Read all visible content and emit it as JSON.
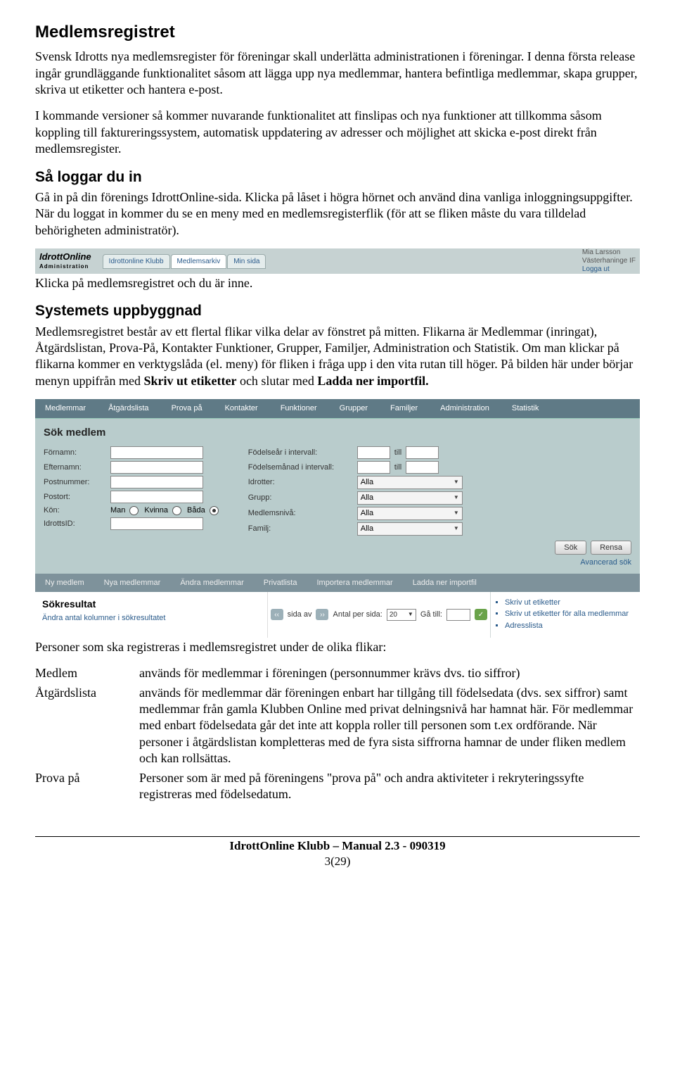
{
  "h1": "Medlemsregistret",
  "p1": "Svensk Idrotts nya medlemsregister för föreningar skall underlätta administrationen i föreningar. I denna första release ingår grundläggande funktionalitet såsom att lägga upp nya medlemmar, hantera befintliga medlemmar, skapa grupper, skriva ut etiketter och hantera e-post.",
  "p2": "I kommande versioner så kommer nuvarande funktionalitet att finslipas och nya funktioner att tillkomma såsom koppling till faktureringssystem, automatisk uppdatering av adresser och möjlighet att skicka e-post direkt från medlemsregister.",
  "h2a": "Så loggar du in",
  "p3": "Gå in på din förenings IdrottOnline-sida. Klicka på låset i högra hörnet och använd dina vanliga inloggningsuppgifter. När du loggat in kommer du se en meny med en medlemsregisterflik (för att se fliken måste du vara tilldelad behörigheten administratör).",
  "banner1": {
    "logo1": "IdrottOnline",
    "logo2": "Administration",
    "tabs": [
      "Idrottonline Klubb",
      "Medlemsarkiv",
      "Min sida"
    ],
    "activeTab": 1,
    "userName": "Mia Larsson",
    "userOrg": "Västerhaninge IF",
    "logout": "Logga ut"
  },
  "p4": "Klicka på medlemsregistret och du är inne.",
  "h2b": "Systemets uppbyggnad",
  "p5a": "Medlemsregistret består av ett flertal flikar vilka delar av fönstret på mitten. Flikarna är Medlemmar (inringat), Åtgärdslistan, Prova-På, Kontakter  Funktioner, Grupper, Familjer, Administration och Statistik. Om man klickar på flikarna kommer en verktygslåda (el. meny) för fliken i fråga upp i den vita rutan till höger. På bilden här under börjar menyn uppifrån med ",
  "p5b": "Skriv ut etiketter",
  "p5c": " och slutar med ",
  "p5d": "Ladda ner importfil.",
  "shot2": {
    "topbar": [
      "Medlemmar",
      "Åtgärdslista",
      "Prova på",
      "Kontakter",
      "Funktioner",
      "Grupper",
      "Familjer",
      "Administration",
      "Statistik"
    ],
    "panelTitle": "Sök medlem",
    "leftLabels": {
      "fornamn": "Förnamn:",
      "efternamn": "Efternamn:",
      "postnummer": "Postnummer:",
      "postort": "Postort:",
      "kon": "Kön:",
      "idrottsid": "IdrottsID:"
    },
    "konOptions": {
      "man": "Man",
      "kvinna": "Kvinna",
      "bada": "Båda"
    },
    "rightLabels": {
      "fodelsear": "Födelseår i intervall:",
      "fodelsemanad": "Födelsemånad i intervall:",
      "idrotter": "Idrotter:",
      "grupp": "Grupp:",
      "medlemsniva": "Medlemsnivå:",
      "familj": "Familj:"
    },
    "till": "till",
    "alla": "Alla",
    "btnSok": "Sök",
    "btnRensa": "Rensa",
    "adv": "Avancerad sök",
    "midbar": [
      "Ny medlem",
      "Nya medlemmar",
      "Ändra medlemmar",
      "Privatlista",
      "Importera medlemmar",
      "Ladda ner importfil"
    ],
    "sokresultat": "Sökresultat",
    "changeCols": "Ändra antal kolumner i sökresultatet",
    "sidaAv": "sida av",
    "perSida": "Antal per sida:",
    "perSidaVal": "20",
    "gaTill": "Gå till:",
    "sideLinks": [
      "Skriv ut etiketter",
      "Skriv ut etiketter för alla medlemmar",
      "Adresslista"
    ]
  },
  "p6": "Personer som ska registreras i medlemsregistret under de olika flikar:",
  "defs": {
    "t1": "Medlem",
    "d1": "används för medlemmar i föreningen (personnummer krävs dvs. tio siffror)",
    "t2": "Åtgärdslista",
    "d2": "används för medlemmar där föreningen enbart har tillgång till födelsedata (dvs. sex siffror) samt medlemmar från gamla Klubben Online med privat delningsnivå har hamnat här. För medlemmar med enbart födelsedata går det inte att koppla roller till personen som t.ex ordförande. När personer i åtgärdslistan kompletteras med de fyra sista siffrorna hamnar de under fliken medlem och kan rollsättas.",
    "t3": "Prova på",
    "d3": "Personer som är med på föreningens \"prova på\" och andra aktiviteter i rekryteringssyfte registreras med födelsedatum."
  },
  "footer": {
    "line1": "IdrottOnline Klubb – Manual  2.3 - 090319",
    "line2": "3(29)"
  }
}
